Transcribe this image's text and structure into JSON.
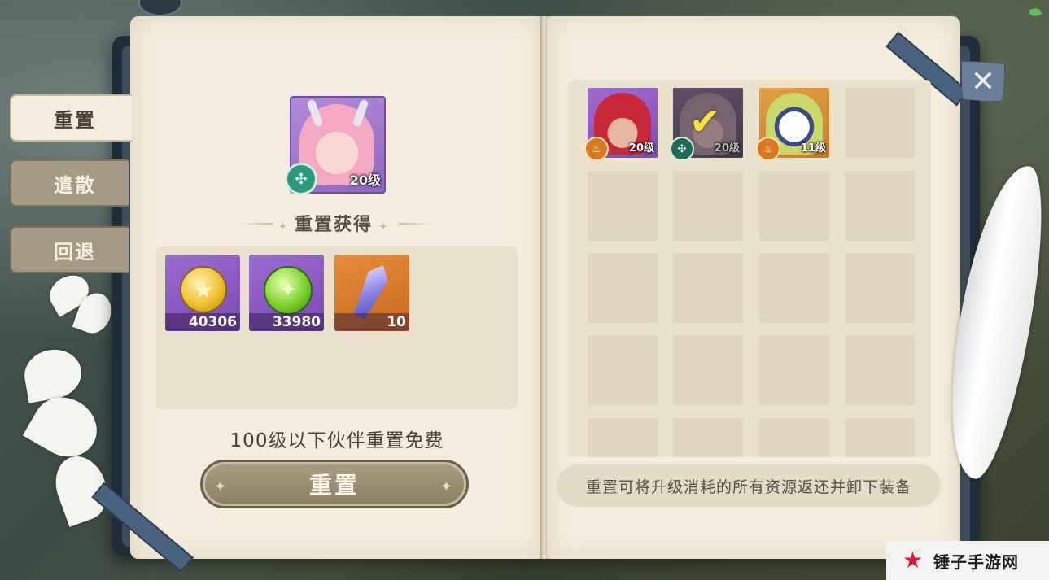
{
  "tabs": [
    {
      "label": "重置",
      "active": true
    },
    {
      "label": "遣散",
      "active": false
    },
    {
      "label": "回退",
      "active": false
    }
  ],
  "selected_hero": {
    "level_label": "20级",
    "element_icon": "wind-icon"
  },
  "reward_section": {
    "title": "重置获得",
    "items": [
      {
        "icon": "gold-coin-icon",
        "count": "40306",
        "rarity": "purple"
      },
      {
        "icon": "green-exp-orb-icon",
        "count": "33980",
        "rarity": "purple"
      },
      {
        "icon": "crystal-shard-icon",
        "count": "10",
        "rarity": "orange"
      }
    ]
  },
  "free_note": "100级以下伙伴重置免费",
  "reset_button": {
    "label": "重置"
  },
  "roster": [
    {
      "name_icon": "red-horned-hero-icon",
      "level_label": "20级",
      "element_icon": "fire-icon",
      "selected": false
    },
    {
      "name_icon": "pink-horned-hero-icon",
      "level_label": "20级",
      "element_icon": "wind-icon",
      "selected": true
    },
    {
      "name_icon": "clown-hero-icon",
      "level_label": "11级",
      "element_icon": "fire-icon",
      "selected": false
    }
  ],
  "tip": "重置可将升级消耗的所有资源返还并卸下装备",
  "watermark": "锤子手游网",
  "colors": {
    "page": "#f4ecdc",
    "frame": "#1f2d3a",
    "button": "#9a8e74",
    "accent_strap": "#4a6480"
  }
}
